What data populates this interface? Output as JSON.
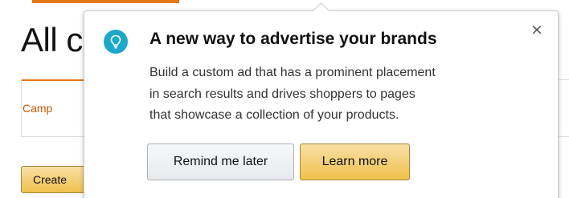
{
  "page": {
    "title": "All c",
    "tab_campaigns": "Camp",
    "create_button_label": "Create"
  },
  "popover": {
    "icon": "lightbulb-icon",
    "title": "A new way to advertise your brands",
    "body_lines": [
      "Build a custom ad that has a prominent placement",
      "in search results and drives shoppers to pages",
      "that showcase a collection of your products."
    ],
    "close_symbol": "×",
    "buttons": {
      "remind_label": "Remind me later",
      "learn_label": "Learn more"
    }
  },
  "colors": {
    "accent_orange": "#e47911",
    "tab_text": "#c45500",
    "icon_teal": "#1ba8c9",
    "primary_button": "#f0c14b",
    "secondary_button": "#e7e9ec"
  }
}
